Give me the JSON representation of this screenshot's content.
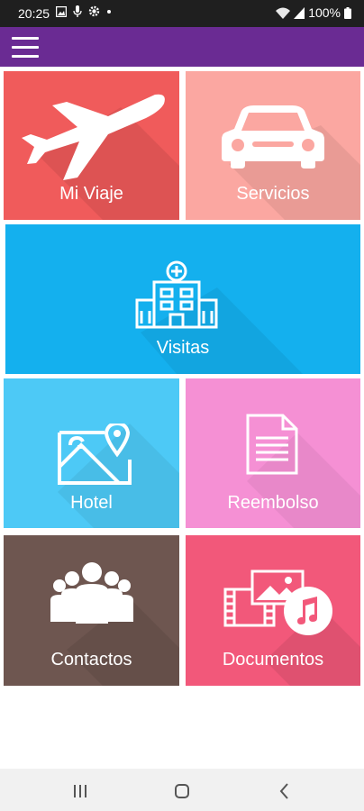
{
  "status_bar": {
    "time": "20:25",
    "battery": "100%",
    "icons_left": [
      "image-icon",
      "mic-icon",
      "settings-icon",
      "dot-icon"
    ],
    "icons_right": [
      "wifi-icon",
      "signal-icon",
      "battery-icon"
    ]
  },
  "app_bar": {
    "menu_icon": "hamburger-menu-icon",
    "color": "#6a2b93"
  },
  "tiles": [
    {
      "id": "mi-viaje",
      "label": "Mi Viaje",
      "icon": "airplane-icon",
      "color": "#f05b5b"
    },
    {
      "id": "servicios",
      "label": "Servicios",
      "icon": "car-icon",
      "color": "#fba7a1"
    },
    {
      "id": "visitas",
      "label": "Visitas",
      "icon": "hospital-icon",
      "color": "#14b0ee"
    },
    {
      "id": "hotel",
      "label": "Hotel",
      "icon": "map-icon",
      "color": "#4dc9f6"
    },
    {
      "id": "reembolso",
      "label": "Reembolso",
      "icon": "document-icon",
      "color": "#f590d4"
    },
    {
      "id": "contactos",
      "label": "Contactos",
      "icon": "group-icon",
      "color": "#6e5650"
    },
    {
      "id": "documentos",
      "label": "Documentos",
      "icon": "media-files-icon",
      "color": "#f2587a"
    }
  ],
  "nav_bar": {
    "buttons": [
      "recent-apps-icon",
      "home-icon",
      "back-icon"
    ]
  }
}
